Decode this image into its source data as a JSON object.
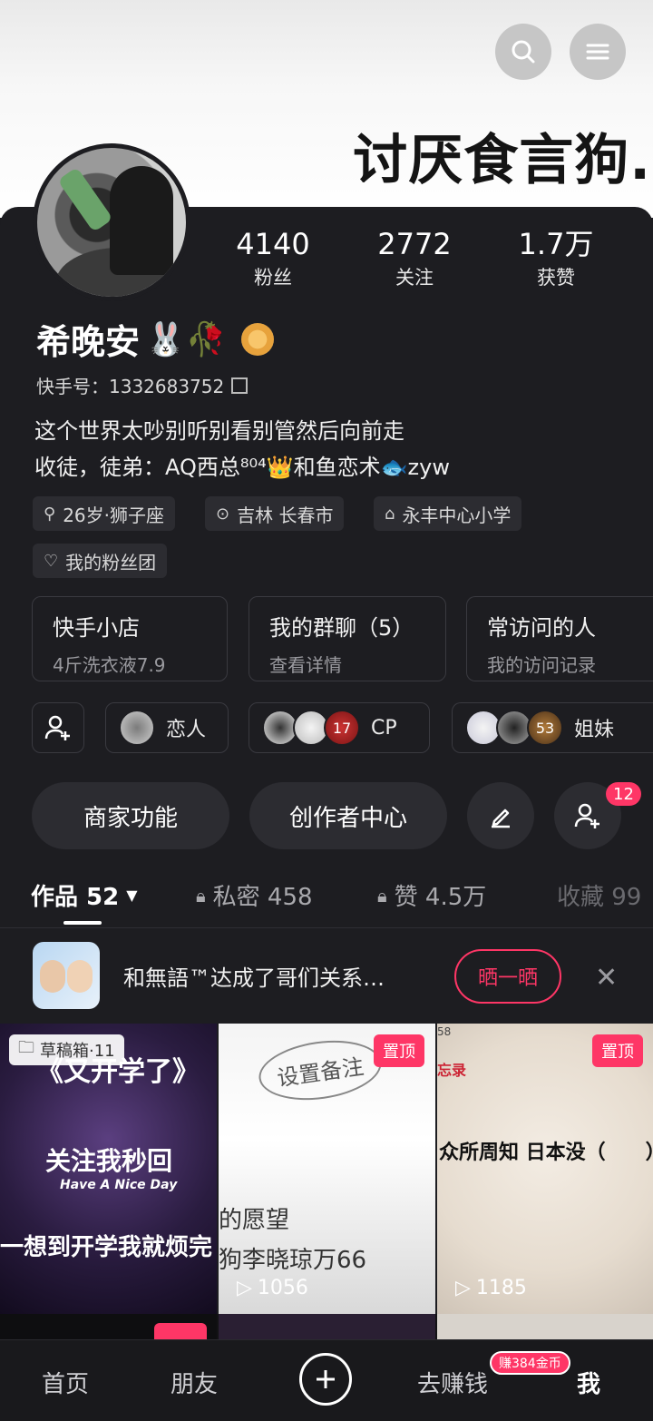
{
  "banner": {
    "text": "讨厌食言狗."
  },
  "profile": {
    "name": "希晚安",
    "name_emojis": "🐰🥀",
    "kuaishou_id": "快手号：1332683752",
    "bio_line1": "这个世界太吵别听别看别管然后向前走",
    "bio_line2": "收徒，徒弟：AQ西总⁸⁰⁴👑和鱼恋术🐟zyw"
  },
  "stats": [
    {
      "value": "4140",
      "label": "粉丝"
    },
    {
      "value": "2772",
      "label": "关注"
    },
    {
      "value": "1.7万",
      "label": "获赞"
    }
  ],
  "tags": {
    "age": "26岁·狮子座",
    "location": "吉林 长春市",
    "school": "永丰中心小学",
    "fan_group": "我的粉丝团"
  },
  "boxes": [
    {
      "title": "快手小店",
      "sub": "4斤洗衣液7.9"
    },
    {
      "title": "我的群聊（5）",
      "sub": "查看详情"
    },
    {
      "title": "常访问的人",
      "sub": "我的访问记录"
    }
  ],
  "relations": [
    {
      "label": "恋人"
    },
    {
      "label": "CP",
      "overlay": "17"
    },
    {
      "label": "姐妹",
      "overlay": "53"
    }
  ],
  "actions": {
    "merchant": "商家功能",
    "creator": "创作者中心",
    "add_friend_badge": "12"
  },
  "tabs": [
    {
      "label": "作品 52"
    },
    {
      "label": "私密 458"
    },
    {
      "label": "赞 4.5万"
    },
    {
      "label": "收藏 99"
    }
  ],
  "notice": {
    "text": "和無語™达成了哥们关系…",
    "button": "晒一晒"
  },
  "videos": [
    {
      "draft": "草稿箱·11",
      "line1": "《又开学了》",
      "line2": "关注我秒回",
      "line3": "Have A Nice Day",
      "line4": "一想到开学我就烦完"
    },
    {
      "pin": "置顶",
      "stamp": "设置备注",
      "line1": "的愿望",
      "line2": "狗李晓琼万66",
      "plays": "1056"
    },
    {
      "pin": "置顶",
      "corner": "58",
      "memo": "忘录",
      "line1": "众所周知 日本没（　　）",
      "plays": "1185"
    }
  ],
  "bottom_nav": {
    "home": "首页",
    "friends": "朋友",
    "earn": "去赚钱",
    "earn_badge": "赚384金币",
    "me": "我"
  },
  "colors": {
    "accent": "#fe3666",
    "background": "#1d1d21"
  }
}
